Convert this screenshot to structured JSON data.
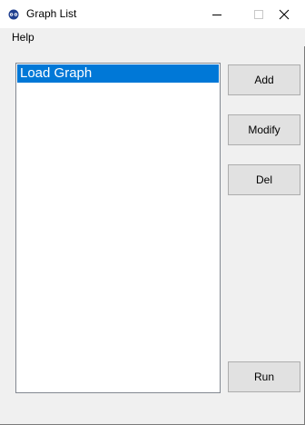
{
  "window": {
    "title": "Graph List",
    "icon": "graph-app-icon"
  },
  "titlebar_controls": {
    "minimize_icon": "minimize-icon",
    "maximize_icon": "maximize-icon",
    "close_icon": "close-icon"
  },
  "menu": {
    "items": [
      {
        "label": "Help"
      }
    ]
  },
  "graph_list": {
    "items": [
      {
        "label": "Load Graph",
        "selected": true
      }
    ],
    "selection_color": "#0078d7"
  },
  "buttons": {
    "add_label": "Add",
    "modify_label": "Modify",
    "del_label": "Del",
    "run_label": "Run"
  }
}
